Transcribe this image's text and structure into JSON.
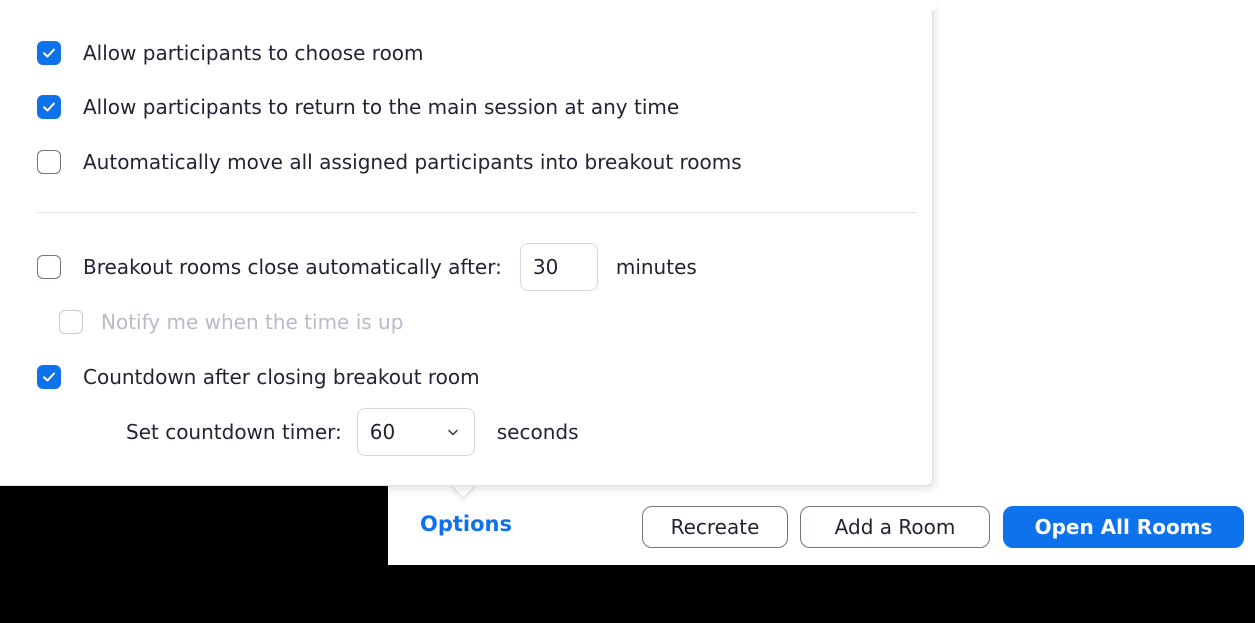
{
  "options_panel": {
    "allow_choose_room": {
      "label": "Allow participants to choose room",
      "checked": true
    },
    "allow_return_main": {
      "label": "Allow participants to return to the main session at any time",
      "checked": true
    },
    "auto_move": {
      "label": "Automatically move all assigned participants into breakout rooms",
      "checked": false
    },
    "auto_close": {
      "label": "Breakout rooms close automatically after:",
      "checked": false,
      "minutes_value": "30",
      "minutes_unit": "minutes"
    },
    "notify": {
      "label": "Notify me when the time is up",
      "checked": false,
      "disabled": true
    },
    "countdown": {
      "label": "Countdown after closing breakout room",
      "checked": true
    },
    "countdown_timer": {
      "label": "Set countdown timer:",
      "selected": "60",
      "unit": "seconds"
    }
  },
  "footer": {
    "options_label": "Options",
    "recreate_label": "Recreate",
    "add_room_label": "Add a Room",
    "open_all_label": "Open All Rooms"
  },
  "colors": {
    "accent": "#0e72ed",
    "background_outside": "#000000"
  },
  "icons": {
    "checkmark": "check-icon",
    "select_arrow": "chevron-down-icon"
  }
}
